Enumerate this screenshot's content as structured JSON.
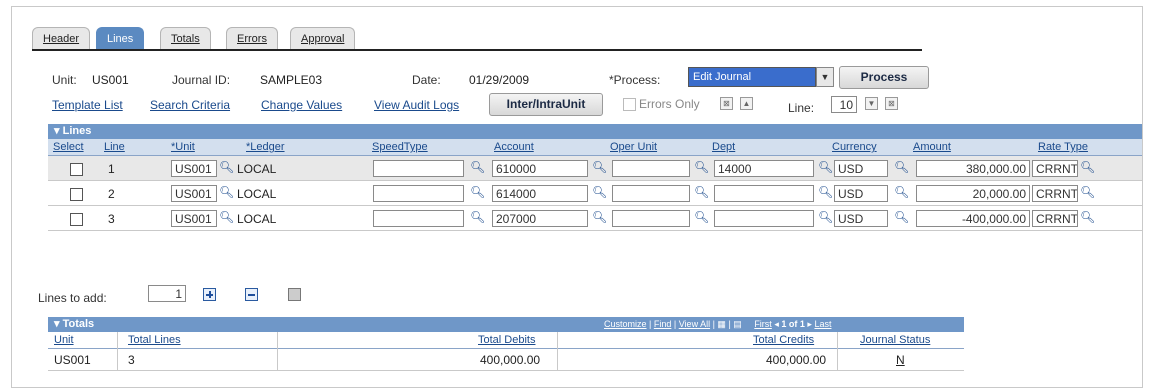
{
  "tabs": [
    {
      "label": "Header"
    },
    {
      "label": "Lines"
    },
    {
      "label": "Totals"
    },
    {
      "label": "Errors"
    },
    {
      "label": "Approval"
    }
  ],
  "info": {
    "unit_label": "Unit:",
    "unit_value": "US001",
    "journal_label": "Journal ID:",
    "journal_value": "SAMPLE03",
    "date_label": "Date:",
    "date_value": "01/29/2009",
    "process_label": "*Process:",
    "process_selected": "Edit Journal",
    "process_button": "Process"
  },
  "links": {
    "template_list": "Template List",
    "search_criteria": "Search Criteria",
    "change_values": "Change Values",
    "view_audit_logs": "View Audit Logs",
    "inter_intra_button": "Inter/IntraUnit",
    "errors_only": "Errors Only",
    "line_label": "Line:",
    "line_value": "10"
  },
  "lines_grid": {
    "title": "Lines",
    "columns": [
      "Select",
      "Line",
      "*Unit",
      "*Ledger",
      "SpeedType",
      "Account",
      "Oper Unit",
      "Dept",
      "Currency",
      "Amount",
      "Rate Type"
    ],
    "rows": [
      {
        "line": "1",
        "unit": "US001",
        "ledger": "LOCAL",
        "speedtype": "",
        "account": "610000",
        "oper_unit": "",
        "dept": "14000",
        "currency": "USD",
        "amount": "380,000.00",
        "rate_type": "CRRNT"
      },
      {
        "line": "2",
        "unit": "US001",
        "ledger": "LOCAL",
        "speedtype": "",
        "account": "614000",
        "oper_unit": "",
        "dept": "",
        "currency": "USD",
        "amount": "20,000.00",
        "rate_type": "CRRNT"
      },
      {
        "line": "3",
        "unit": "US001",
        "ledger": "LOCAL",
        "speedtype": "",
        "account": "207000",
        "oper_unit": "",
        "dept": "",
        "currency": "USD",
        "amount": "-400,000.00",
        "rate_type": "CRRNT"
      }
    ]
  },
  "lines_to_add": {
    "label": "Lines to add:",
    "value": "1"
  },
  "totals_grid": {
    "title": "Totals",
    "nav": {
      "customize": "Customize",
      "find": "Find",
      "view_all": "View All",
      "first": "First",
      "count": "1 of 1",
      "last": "Last"
    },
    "columns": [
      "Unit",
      "Total Lines",
      "Total Debits",
      "Total Credits",
      "Journal Status"
    ],
    "row": {
      "unit": "US001",
      "total_lines": "3",
      "total_debits": "400,000.00",
      "total_credits": "400,000.00",
      "journal_status": "N"
    }
  },
  "colors": {
    "tab_active": "#5b8ac1",
    "grid_header": "#6f97c8",
    "link": "#1a4a8c"
  }
}
